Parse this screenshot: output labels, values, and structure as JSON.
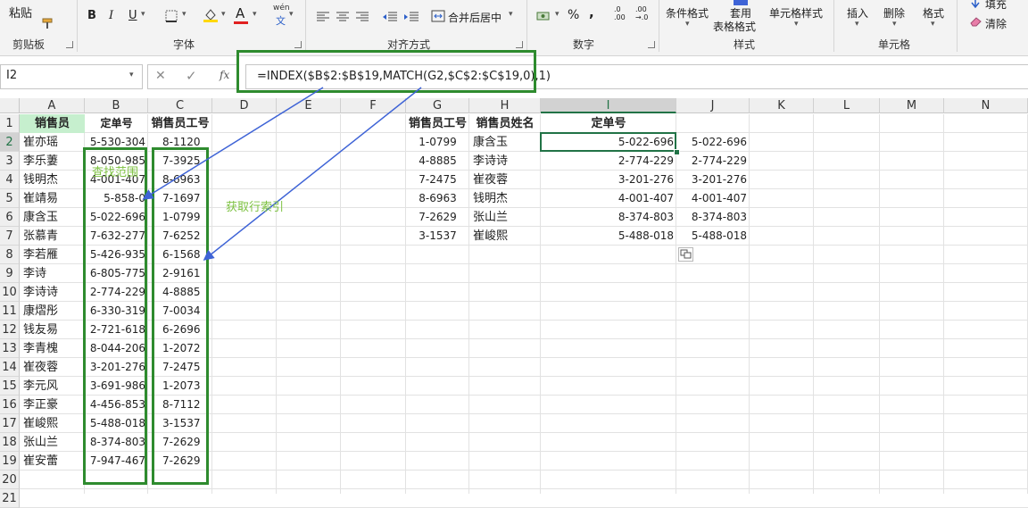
{
  "ribbon": {
    "paste_label": "粘贴",
    "clipboard_group": "剪贴板",
    "font_group": "字体",
    "bold": "B",
    "italic": "I",
    "underline": "U",
    "font_color_letter": "A",
    "phonetic_label": "wén",
    "phonetic_sub": "文",
    "align_group": "对齐方式",
    "merge_label": "合并后居中",
    "number_group": "数字",
    "percent": "%",
    "comma": ",",
    "dec_inc_top": ".0",
    "dec_inc_bottom": ".00",
    "dec_dec_top": ".00",
    "dec_dec_bottom": "→.0",
    "cond_format": "条件格式",
    "table_format_1": "套用",
    "table_format_2": "表格格式",
    "cell_style": "单元格样式",
    "styles_group": "样式",
    "insert": "插入",
    "delete": "删除",
    "format": "格式",
    "cells_group": "单元格",
    "fill": "填充",
    "clear": "清除"
  },
  "formula_bar": {
    "name_box": "I2",
    "fx": "fx",
    "cancel": "✕",
    "confirm": "✓",
    "formula": "=INDEX($B$2:$B$19,MATCH(G2,$C$2:$C$19,0),1)"
  },
  "columns": [
    "A",
    "B",
    "C",
    "D",
    "E",
    "F",
    "G",
    "H",
    "I",
    "J",
    "K",
    "L",
    "M",
    "N"
  ],
  "rows": [
    "1",
    "2",
    "3",
    "4",
    "5",
    "6",
    "7",
    "8",
    "9",
    "10",
    "11",
    "12",
    "13",
    "14",
    "15",
    "16",
    "17",
    "18",
    "19",
    "20",
    "21"
  ],
  "left_table": {
    "headers": [
      "销售员",
      "定单号",
      "销售员工号"
    ],
    "rows": [
      [
        "崔亦瑶",
        "5-530-304",
        "8-1120"
      ],
      [
        "李乐萋",
        "8-050-985",
        "7-3925"
      ],
      [
        "钱明杰",
        "4-001-407",
        "8-6963"
      ],
      [
        "崔靖易",
        "5-858-0",
        "7-1697"
      ],
      [
        "康含玉",
        "5-022-696",
        "1-0799"
      ],
      [
        "张慕青",
        "7-632-277",
        "7-6252"
      ],
      [
        "李若雁",
        "5-426-935",
        "6-1568"
      ],
      [
        "李诗",
        "6-805-775",
        "2-9161"
      ],
      [
        "李诗诗",
        "2-774-229",
        "4-8885"
      ],
      [
        "康熠彤",
        "6-330-319",
        "7-0034"
      ],
      [
        "钱友易",
        "2-721-618",
        "6-2696"
      ],
      [
        "李青槐",
        "8-044-206",
        "1-2072"
      ],
      [
        "崔夜蓉",
        "3-201-276",
        "7-2475"
      ],
      [
        "李元风",
        "3-691-986",
        "1-2073"
      ],
      [
        "李正豪",
        "4-456-853",
        "8-7112"
      ],
      [
        "崔峻熙",
        "5-488-018",
        "3-1537"
      ],
      [
        "张山兰",
        "8-374-803",
        "7-2629"
      ],
      [
        "崔安蕾",
        "7-947-467",
        "7-2629"
      ]
    ]
  },
  "right_table": {
    "headers": [
      "销售员工号",
      "销售员姓名",
      "定单号"
    ],
    "rows": [
      [
        "1-0799",
        "康含玉",
        "5-022-696",
        "5-022-696"
      ],
      [
        "4-8885",
        "李诗诗",
        "2-774-229",
        "2-774-229"
      ],
      [
        "7-2475",
        "崔夜蓉",
        "3-201-276",
        "3-201-276"
      ],
      [
        "8-6963",
        "钱明杰",
        "4-001-407",
        "4-001-407"
      ],
      [
        "7-2629",
        "张山兰",
        "8-374-803",
        "8-374-803"
      ],
      [
        "3-1537",
        "崔峻熙",
        "5-488-018",
        "5-488-018"
      ]
    ]
  },
  "annotations": {
    "lookup_range": "查找范围",
    "get_row_index": "获取行索引"
  },
  "colors": {
    "green_box": "#2e8b2e",
    "annotation_text": "#7dc241",
    "arrow": "#3e63d6",
    "header_fill": "#c6efce",
    "selection": "#217346"
  }
}
